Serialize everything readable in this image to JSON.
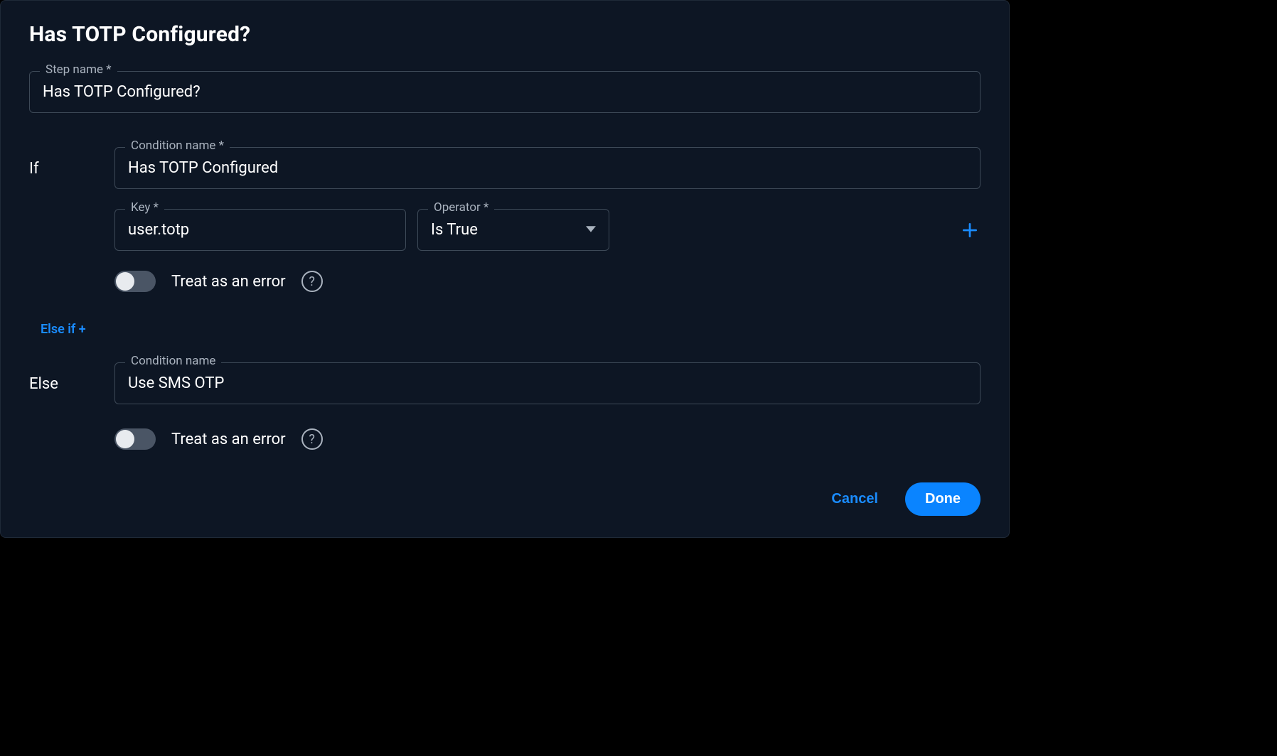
{
  "title": "Has TOTP Configured?",
  "step_name": {
    "label": "Step name *",
    "value": "Has TOTP Configured?"
  },
  "if_block": {
    "keyword": "If",
    "condition_name": {
      "label": "Condition name *",
      "value": "Has TOTP Configured"
    },
    "key": {
      "label": "Key *",
      "value": "user.totp"
    },
    "operator": {
      "label": "Operator *",
      "value": "Is True"
    },
    "treat_as_error_label": "Treat as an error"
  },
  "elseif_link": "Else if +",
  "else_block": {
    "keyword": "Else",
    "condition_name": {
      "label": "Condition name",
      "value": "Use SMS OTP"
    },
    "treat_as_error_label": "Treat as an error"
  },
  "footer": {
    "cancel": "Cancel",
    "done": "Done"
  }
}
